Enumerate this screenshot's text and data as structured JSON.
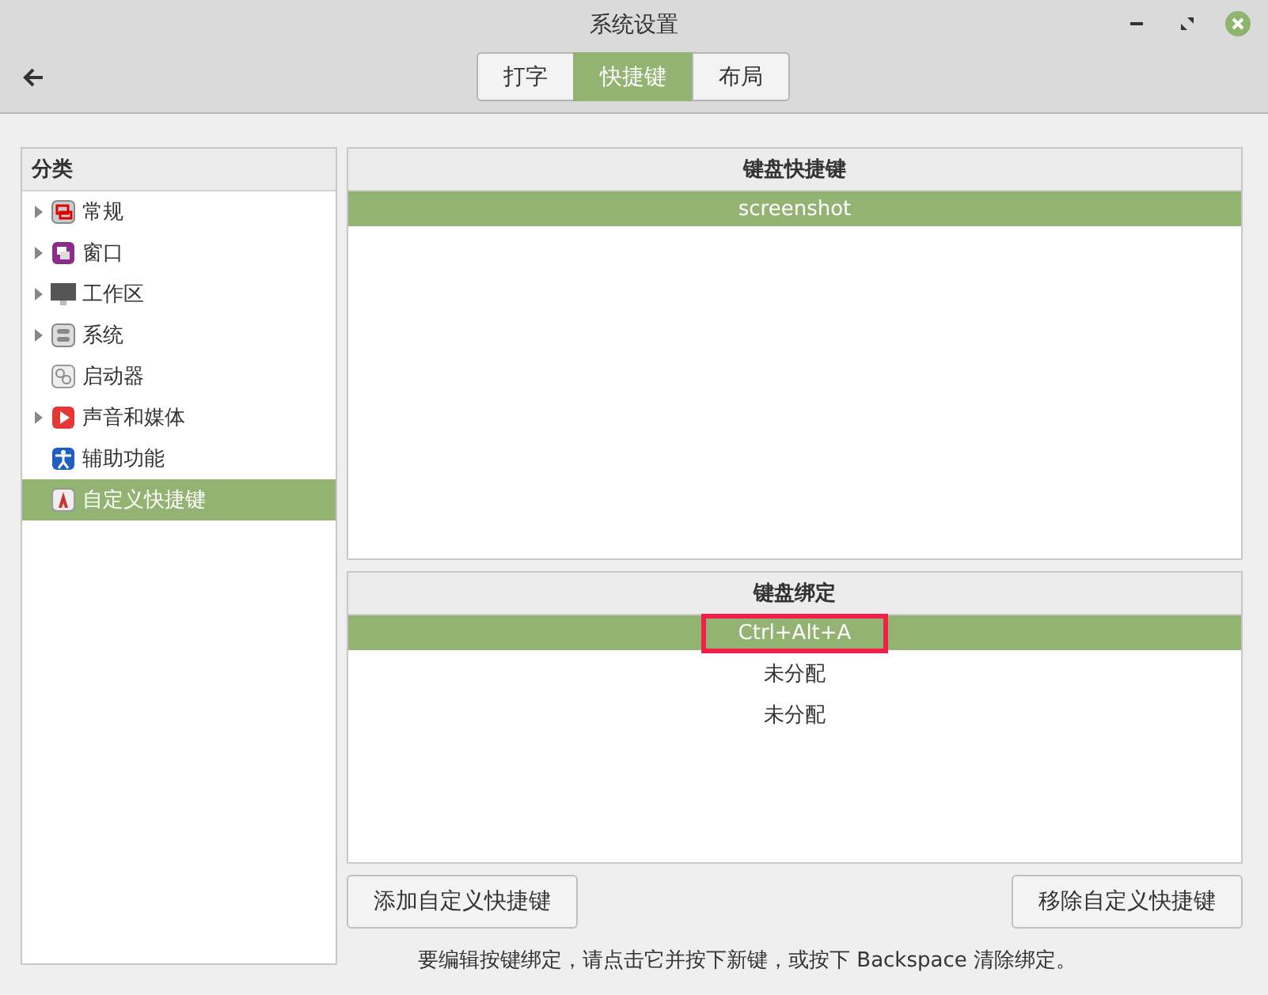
{
  "window": {
    "title": "系统设置"
  },
  "tabs": [
    {
      "label": "打字",
      "selected": false
    },
    {
      "label": "快捷键",
      "selected": true
    },
    {
      "label": "布局",
      "selected": false
    }
  ],
  "sidebar": {
    "heading": "分类",
    "items": [
      {
        "label": "常规",
        "expandable": true,
        "selected": false
      },
      {
        "label": "窗口",
        "expandable": true,
        "selected": false
      },
      {
        "label": "工作区",
        "expandable": true,
        "selected": false
      },
      {
        "label": "系统",
        "expandable": true,
        "selected": false
      },
      {
        "label": "启动器",
        "expandable": false,
        "selected": false
      },
      {
        "label": "声音和媒体",
        "expandable": true,
        "selected": false
      },
      {
        "label": "辅助功能",
        "expandable": false,
        "selected": false
      },
      {
        "label": "自定义快捷键",
        "expandable": false,
        "selected": true
      }
    ]
  },
  "shortcuts": {
    "heading": "键盘快捷键",
    "rows": [
      {
        "label": "screenshot",
        "selected": true
      }
    ]
  },
  "bindings": {
    "heading": "键盘绑定",
    "rows": [
      {
        "label": "Ctrl+Alt+A",
        "selected": true,
        "annotated": true
      },
      {
        "label": "未分配",
        "selected": false,
        "annotated": false
      },
      {
        "label": "未分配",
        "selected": false,
        "annotated": false
      }
    ]
  },
  "buttons": [
    "添加自定义快捷键",
    "移除自定义快捷键"
  ],
  "hint": "要编辑按键绑定，请点击它并按下新键，或按下 Backspace 清除绑定。"
}
